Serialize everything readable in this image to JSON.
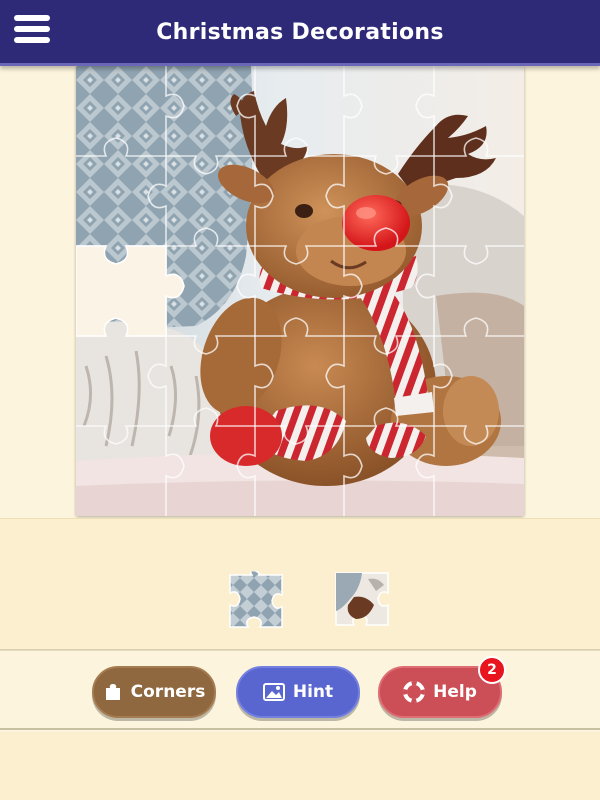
{
  "header": {
    "title": "Christmas Decorations",
    "menu_icon": "hamburger-menu-icon"
  },
  "puzzle": {
    "image_subject": "plush reindeer toy with red nose and striped scarf",
    "grid_rows": 5,
    "grid_cols": 5,
    "tray_piece_count": 2
  },
  "buttons": {
    "corners_label": "Corners",
    "hint_label": "Hint",
    "help_label": "Help",
    "help_badge": "2"
  },
  "colors": {
    "header": "#2e2a78",
    "corners": "#8f6840",
    "hint": "#5a66cf",
    "help": "#cc4e56",
    "badge": "#e8141e"
  }
}
